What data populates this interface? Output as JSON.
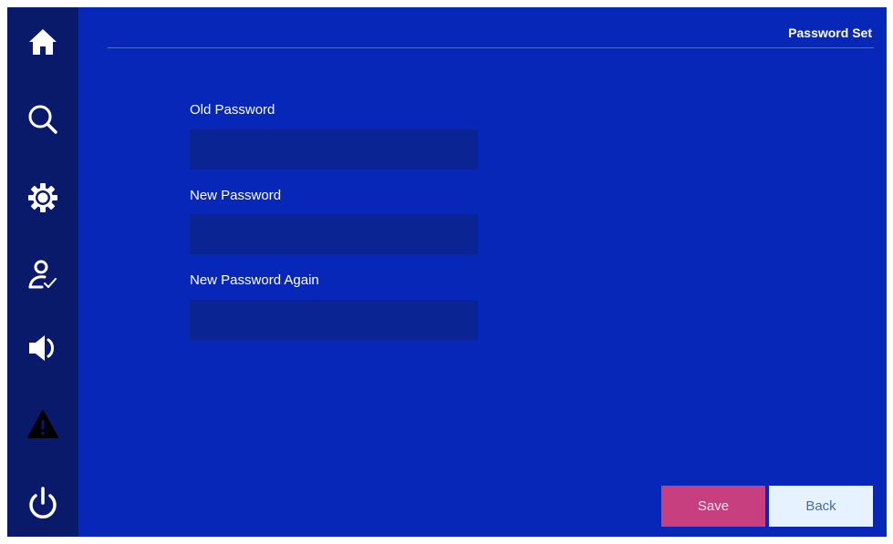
{
  "header": {
    "title": "Password Set"
  },
  "sidebar": {
    "items": [
      {
        "name": "home",
        "icon": "home-icon"
      },
      {
        "name": "search",
        "icon": "search-icon"
      },
      {
        "name": "settings",
        "icon": "gear-icon"
      },
      {
        "name": "user",
        "icon": "user-check-icon"
      },
      {
        "name": "sound",
        "icon": "speaker-icon"
      },
      {
        "name": "alarm",
        "icon": "warning-icon"
      },
      {
        "name": "power",
        "icon": "power-icon"
      }
    ]
  },
  "form": {
    "old_password_label": "Old Password",
    "old_password_value": "",
    "new_password_label": "New Password",
    "new_password_value": "",
    "new_password_again_label": "New Password Again",
    "new_password_again_value": ""
  },
  "buttons": {
    "save_label": "Save",
    "back_label": "Back"
  },
  "colors": {
    "background": "#0727b8",
    "sidebar": "#0a1a6b",
    "input": "#0a2494",
    "save_button": "#c73f7f",
    "back_button": "#e6f2ff"
  }
}
